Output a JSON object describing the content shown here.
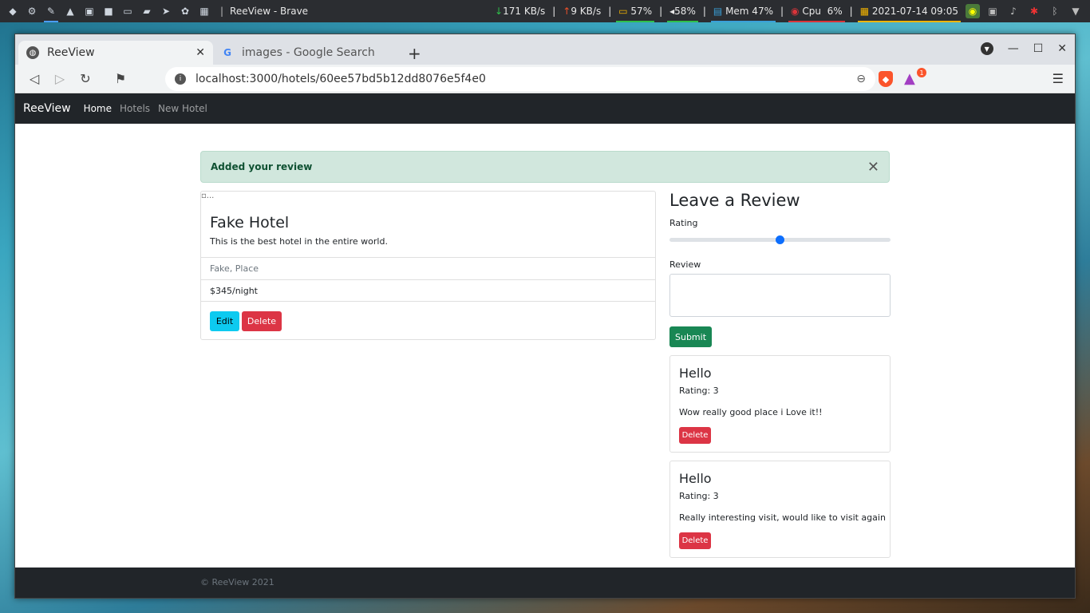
{
  "taskbar": {
    "app_icons": [
      "brave-icon",
      "settings-icon",
      "pipette-icon",
      "flask-icon",
      "image-icon",
      "video-icon",
      "laptop-icon",
      "folder-icon",
      "telegram-icon",
      "paw-icon",
      "grid-icon"
    ],
    "window_title": "ReeView - Brave",
    "net_down": "171 KB/s",
    "net_up": "9 KB/s",
    "battery": "57%",
    "volume": "58%",
    "mem": "Mem 47%",
    "cpu_label": "Cpu",
    "cpu_value": "6%",
    "datetime": "2021-07-14 09:05"
  },
  "browser": {
    "tabs": [
      {
        "label": "ReeView",
        "active": true
      },
      {
        "label": "images - Google Search",
        "active": false
      }
    ],
    "url": "localhost:3000/hotels/60ee57bd5b12dd8076e5f4e0",
    "rewards_badge": "1"
  },
  "navbar": {
    "brand": "ReeView",
    "links": [
      "Home",
      "Hotels",
      "New Hotel"
    ]
  },
  "alert": {
    "message": "Added your review"
  },
  "hotel": {
    "image_alt": "...",
    "title": "Fake Hotel",
    "description": "This is the best hotel in the entire world.",
    "location": "Fake, Place",
    "price": "$345/night",
    "edit_label": "Edit",
    "delete_label": "Delete"
  },
  "review_form": {
    "title": "Leave a Review",
    "rating_label": "Rating",
    "rating_value": 0.5,
    "review_label": "Review",
    "submit_label": "Submit"
  },
  "reviews": [
    {
      "title": "Hello",
      "rating": "Rating: 3",
      "body": "Wow really good place i Love it!!",
      "delete_label": "Delete"
    },
    {
      "title": "Hello",
      "rating": "Rating: 3",
      "body": "Really interesting visit, would like to visit again",
      "delete_label": "Delete"
    }
  ],
  "footer": {
    "text": "© ReeView 2021"
  },
  "colors": {
    "net_bar": "#f4b400",
    "battery_bar": "#2fbf4a",
    "volume_bar": "#2fbf4a",
    "mem_bar": "#3aa0d8",
    "cpu_bar": "#d9343a",
    "date_bar": "#f4b400"
  }
}
